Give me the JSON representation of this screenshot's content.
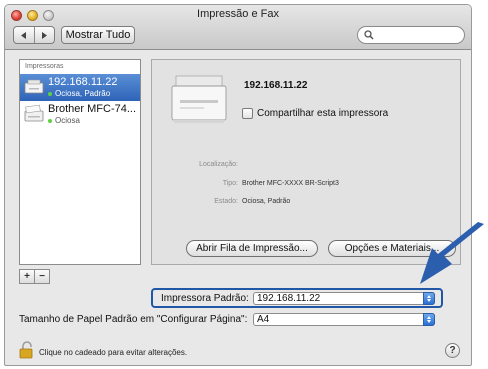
{
  "window": {
    "title": "Impressão e Fax"
  },
  "toolbar": {
    "back_icon": "triangle-left-icon",
    "forward_icon": "triangle-right-icon",
    "show_all_label": "Mostrar Tudo",
    "search_value": "",
    "search_icon": "magnifier-icon"
  },
  "printers": {
    "header": "Impressoras",
    "items": [
      {
        "name": "192.168.11.22",
        "status": "Ociosa, Padrão",
        "selected": true
      },
      {
        "name": "Brother MFC-74...",
        "status": "Ociosa",
        "selected": false
      }
    ],
    "add_label": "+",
    "remove_label": "−"
  },
  "detail": {
    "name": "192.168.11.22",
    "share_label": "Compartilhar esta impressora",
    "share_checked": false,
    "location_label": "Localização:",
    "location_value": "",
    "type_label": "Tipo:",
    "type_value": "Brother MFC-XXXX BR-Script3",
    "status_label": "Estado:",
    "status_value": "Ociosa, Padrão",
    "open_queue_label": "Abrir Fila de Impressão...",
    "options_label": "Opções e Materiais..."
  },
  "defaults": {
    "default_printer_label": "Impressora Padrão:",
    "default_printer_value": "192.168.11.22",
    "paper_size_label": "Tamanho de Papel Padrão em \"Configurar Página\":",
    "paper_size_value": "A4"
  },
  "footer": {
    "lock_text": "Clique no cadeado para evitar alterações.",
    "help_label": "?"
  },
  "colors": {
    "selection": "#3d74c7",
    "highlight_border": "#2057a6",
    "callout_arrow": "#2b5fae",
    "status_dot": "#5fcf3f"
  }
}
